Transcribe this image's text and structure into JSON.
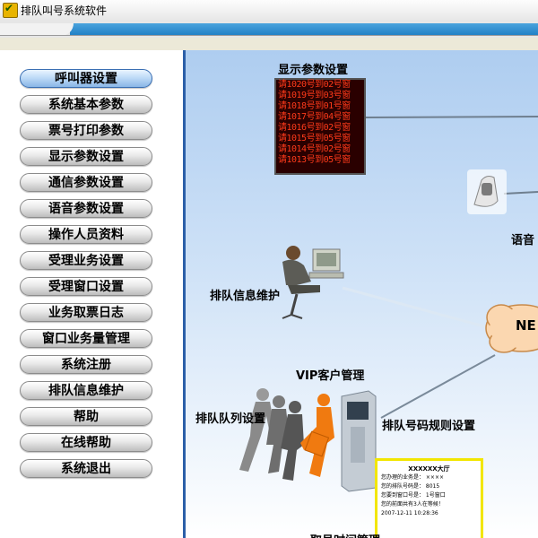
{
  "window": {
    "title": "排队叫号系统软件"
  },
  "menu": {
    "items": [
      "呼叫器设置",
      "系统基本参数",
      "票号打印参数",
      "显示参数设置",
      "通信参数设置",
      "语音参数设置",
      "操作人员资料",
      "受理业务设置",
      "受理窗口设置",
      "业务取票日志",
      "窗口业务量管理",
      "系统注册",
      "排队信息维护",
      "帮助",
      "在线帮助",
      "系统退出"
    ],
    "active_index": 0
  },
  "diagram": {
    "display_label": "显示参数设置",
    "voice_label": "语音",
    "queue_info_label": "排队信息维护",
    "network_label": "NE",
    "vip_label": "VIP客户管理",
    "queue_list_label": "排队队列设置",
    "number_rule_label": "排队号码规则设置",
    "time_label": "取号时间管理",
    "led_rows": [
      "请1020号到02号窗",
      "请1019号到03号窗",
      "请1018号到01号窗",
      "请1017号到04号窗",
      "请1016号到02号窗",
      "请1015号到05号窗",
      "请1014号到02号窗",
      "请1013号到05号窗"
    ],
    "ticket": {
      "title": "XXXXXX大厅",
      "lines": [
        "您办理的业务是： ××××",
        "您的排队号码是： 8015",
        "您要到窗口号是： 1号窗口",
        "您的前面共有3人在等候！",
        "2007-12-11   10:28:36"
      ]
    }
  },
  "colors": {
    "accent": "#1e7ec4",
    "panel_border": "#2b5fa8",
    "led": "#ff3a1a"
  }
}
